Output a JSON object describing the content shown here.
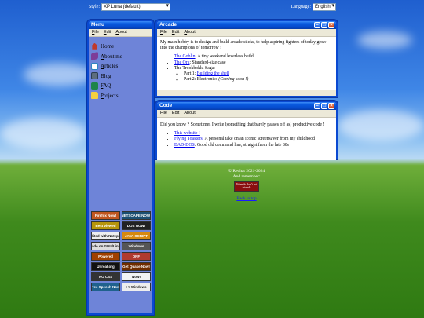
{
  "topbar": {
    "style_label": "Style:",
    "style_value": "XP Luna (default)",
    "language_label": "Language:",
    "language_value": "English"
  },
  "menu_window": {
    "title": "Menu",
    "menus": [
      "File",
      "Edit",
      "About"
    ],
    "items": [
      {
        "label": "Home",
        "icon": "home-icon",
        "color": "#c0392b"
      },
      {
        "label": "About me",
        "icon": "book-icon",
        "color": "#7d3c98"
      },
      {
        "label": "Articles",
        "icon": "document-icon",
        "color": "#2e86c1"
      },
      {
        "label": "Blog",
        "icon": "computer-icon",
        "color": "#5d6d7e"
      },
      {
        "label": "FAQ",
        "icon": "help-book-icon",
        "color": "#1e8449"
      },
      {
        "label": "Projects",
        "icon": "folder-icon",
        "color": "#f4d03f"
      }
    ],
    "badges": [
      {
        "text": "Firefox Now!",
        "color": "#c0561f"
      },
      {
        "text": "NETSCAPE NOW!",
        "color": "#1b4f72"
      },
      {
        "text": "Best viewed",
        "color": "#b7950b"
      },
      {
        "text": "DOS NOW!",
        "color": "#222222"
      },
      {
        "text": "Edited with Notepad",
        "color": "#eeeeee"
      },
      {
        "text": "JAVA SCRIPT",
        "color": "#d68910"
      },
      {
        "text": "Made on GNU/Linux",
        "color": "#dddddd"
      },
      {
        "text": "Windows",
        "color": "#555555"
      },
      {
        "text": "Powered",
        "color": "#a04000"
      },
      {
        "text": "DNF",
        "color": "#b03a2e"
      },
      {
        "text": "Unreal.org",
        "color": "#111111"
      },
      {
        "text": "Get Quake Now!",
        "color": "#6e2c00"
      },
      {
        "text": "NO CSS",
        "color": "#333333"
      },
      {
        "text": "Now!",
        "color": "#f2f3f4"
      },
      {
        "text": "Free Speech Now!",
        "color": "#1f618d"
      },
      {
        "text": "I ♥ Windows",
        "color": "#eeeeee"
      }
    ]
  },
  "arcade_window": {
    "title": "Arcade",
    "menus": [
      "File",
      "Edit",
      "About"
    ],
    "intro": "My main hobby is to design and build arcade sticks, to help aspiring fighters of today grow into the champions of tomorrow !",
    "items": [
      {
        "link": "The Goblin",
        "text": ": A tiny weekend leverless build"
      },
      {
        "link": "The Ork",
        "text": ": Standard-size case"
      },
      {
        "link": "",
        "text": "The Trookbokki Saga:"
      }
    ],
    "subitems": [
      {
        "prefix": "Part 1: ",
        "link": "Building the shell",
        "suffix": ""
      },
      {
        "prefix": "Part 2: Electronics ",
        "link": "",
        "suffix": "(Coming soon !)"
      }
    ]
  },
  "code_window": {
    "title": "Code",
    "menus": [
      "File",
      "Edit",
      "About"
    ],
    "intro": "Did you know ? Sometimes I write (something that barely passes off as) productive code !",
    "items": [
      {
        "link": "This website !",
        "text": ""
      },
      {
        "link": "Flying Toasters",
        "text": ": A personal take on an iconic screensaver from my childhood"
      },
      {
        "link": "BAD-DOS",
        "text": ": Good old command line, straight from the late 80s"
      }
    ]
  },
  "footer": {
    "copyright": "© Redhat 2021-2024",
    "and": "And remember:",
    "stamp": "Friends don't let friends",
    "back_to_top": "Back to top"
  }
}
